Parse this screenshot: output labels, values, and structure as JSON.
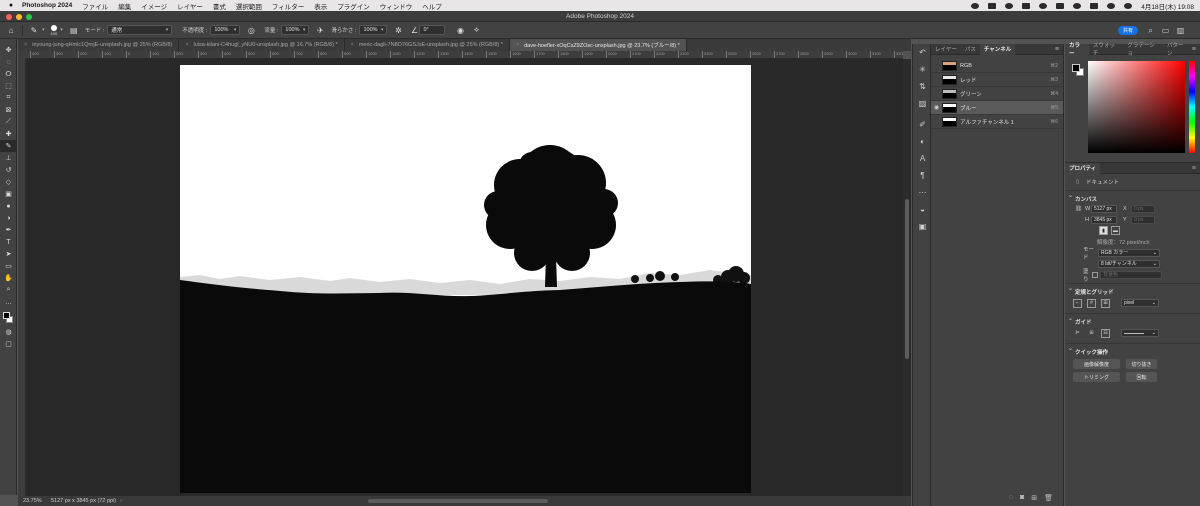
{
  "menubar": {
    "app_name": "Photoshop 2024",
    "items": [
      "ファイル",
      "編集",
      "イメージ",
      "レイヤー",
      "書式",
      "選択範囲",
      "フィルター",
      "表示",
      "プラグイン",
      "ウィンドウ",
      "ヘルプ"
    ],
    "clock": "4月18日(木) 19:08"
  },
  "window": {
    "title": "Adobe Photoshop 2024"
  },
  "options_bar": {
    "brush_size": "100",
    "mode_label": "モード :",
    "mode_value": "通常",
    "opacity_label": "不透明度 :",
    "opacity_value": "100%",
    "flow_label": "流量 :",
    "flow_value": "100%",
    "smoothing_label": "滑らかさ :",
    "smoothing_value": "100%",
    "angle_value": "0°",
    "share_label": "共有"
  },
  "document_tabs": [
    {
      "label": "inyoung-jung-qHmlc1QrnjE-unsplash.jpg @ 25% (RGB/8)",
      "active": false
    },
    {
      "label": "luisa-kilani-C4hugl_yNU0-unsplash.jpg @ 16.7% (RGB/8) *",
      "active": false
    },
    {
      "label": "meric-dagli-7N8O76GSJsE-unsplash.jpg @ 25% (RGB/8) *",
      "active": false
    },
    {
      "label": "dave-hoefler-xOqCsZ9ZOsc-unsplash.jpg @ 23.7% (ブルー/8) *",
      "active": true
    }
  ],
  "ruler_ticks": [
    "400",
    "300",
    "200",
    "100",
    "0",
    "100",
    "200",
    "300",
    "400",
    "500",
    "600",
    "700",
    "800",
    "900",
    "1000",
    "1100",
    "1200",
    "1300",
    "1400",
    "1500",
    "1600",
    "1700",
    "1800",
    "1900",
    "2000",
    "2100",
    "2200",
    "2300",
    "2400",
    "2500",
    "2600",
    "2700",
    "2800",
    "2900",
    "3000",
    "3100",
    "3200",
    "3300",
    "3400",
    "3500",
    "3600",
    "3700",
    "3800",
    "3900",
    "4000",
    "4100",
    "4200",
    "4300",
    "4400",
    "4500",
    "4600",
    "4700",
    "4800",
    "4900",
    "5000",
    "5100",
    "5200",
    "5300",
    "5400",
    "5500"
  ],
  "status_bar": {
    "zoom": "23.75%",
    "doc_info": "5127 px x 3845 px (72 ppi)"
  },
  "layers_panel": {
    "tabs": [
      "レイヤー",
      "パス",
      "チャンネル"
    ],
    "active_tab": "チャンネル",
    "channels": [
      {
        "name": "RGB",
        "shortcut": "⌘2",
        "visible": false,
        "selected": false,
        "sky": "#ffffff"
      },
      {
        "name": "レッド",
        "shortcut": "⌘3",
        "visible": false,
        "selected": false,
        "sky": "#ffffff"
      },
      {
        "name": "グリーン",
        "shortcut": "⌘4",
        "visible": false,
        "selected": false,
        "sky": "#ffffff"
      },
      {
        "name": "ブルー",
        "shortcut": "⌘5",
        "visible": true,
        "selected": true,
        "sky": "#ffffff"
      },
      {
        "name": "アルファチャンネル 1",
        "shortcut": "⌘6",
        "visible": false,
        "selected": false,
        "sky": "#ffffff"
      }
    ]
  },
  "color_panel": {
    "tabs": [
      "カラー",
      "スウォッチ",
      "グラデーショ",
      "パターン"
    ],
    "hue_color": "#ff0000"
  },
  "properties_panel": {
    "tab": "プロパティ",
    "doc_label": "ドキュメント",
    "canvas_title": "カンバス",
    "width_label": "W",
    "width_value": "5127 px",
    "height_label": "H",
    "height_value": "3845 px",
    "x_label": "X",
    "x_value": "0 px",
    "y_label": "Y",
    "y_value": "0 px",
    "resolution": "解像度：72 pixel/inch",
    "mode_label": "モード",
    "mode_value": "RGB カラー",
    "depth_value": "8 bit/チャンネル",
    "fill_label": "塗り",
    "fill_value": "背景色",
    "rulers_title": "定規とグリッド",
    "units_value": "pixel",
    "guides_title": "ガイド",
    "quick_title": "クイック操作",
    "quick_buttons": [
      "画像解像度",
      "切り抜き",
      "トリミング",
      "回転"
    ]
  }
}
